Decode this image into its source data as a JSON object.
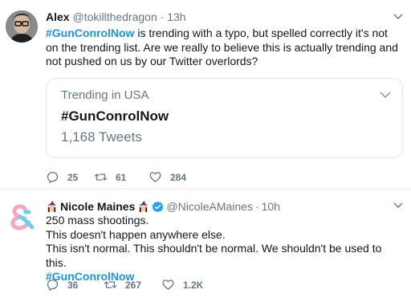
{
  "tweets": [
    {
      "name": "Alex",
      "handle": "@tokillthedragon",
      "dot": "·",
      "time": "13h",
      "text_hashtag": "#GunConrolNow",
      "text_rest": " is trending with a typo, but spelled correctly it's not on the trending list. Are we really to believe this is actually trending and not pushed on us by our Twitter overlords?",
      "card": {
        "subtitle": "Trending in USA",
        "title": "#GunConrolNow",
        "count": "1,168 Tweets"
      },
      "replies": "25",
      "retweets": "61",
      "likes": "284"
    },
    {
      "name": "Nicole Maines",
      "handle": "@NicoleAMaines",
      "dot": "·",
      "time": "10h",
      "lines": [
        "250 mass shootings.",
        "This doesn't happen anywhere else.",
        "This isn't normal. This shouldn't be normal. We shouldn't be used to this."
      ],
      "hashtag": "#GunConrolNow",
      "replies": "36",
      "retweets": "267",
      "likes": "1.2K"
    }
  ],
  "colors": {
    "link": "#1b95e0",
    "muted": "#657786",
    "verified": "#1da1f2",
    "divider": "#e6ecf0"
  },
  "icons": [
    "reply-icon",
    "retweet-icon",
    "like-icon",
    "caret-down-icon",
    "verified-badge-icon",
    "witch-emoji-icon"
  ]
}
